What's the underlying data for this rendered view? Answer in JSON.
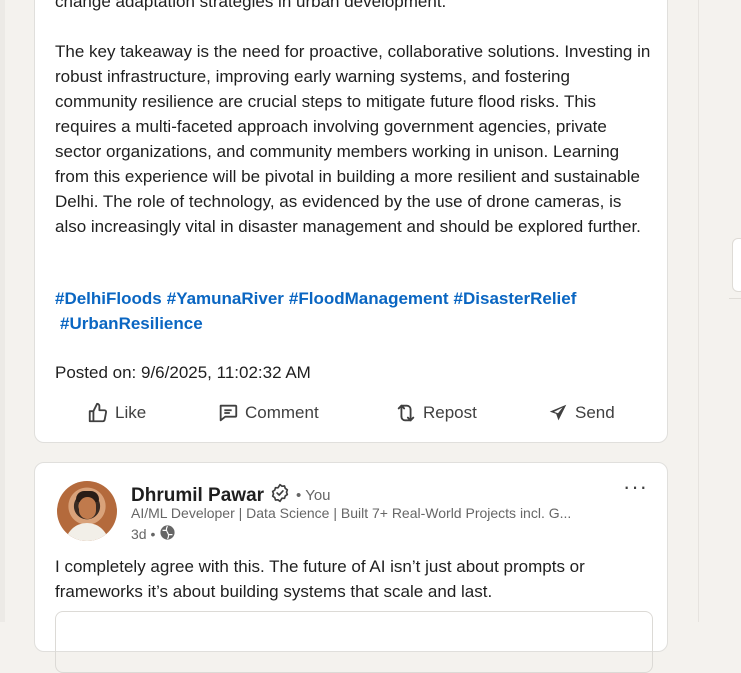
{
  "post": {
    "clipped_line": "change adaptation strategies in urban development.",
    "paragraph": "The key takeaway is the need for proactive, collaborative solutions. Investing in robust infrastructure, improving early warning systems, and fostering community resilience are crucial steps to mitigate future flood risks. This requires a multi-faceted approach involving government agencies, private sector organizations, and community members working in unison. Learning from this experience will be pivotal in building a more resilient and sustainable Delhi. The role of technology, as evidenced by the use of drone cameras, is also increasingly vital in disaster management and should be explored further.",
    "hashtags": [
      "#DelhiFloods",
      "#YamunaRiver",
      "#FloodManagement",
      "#DisasterRelief",
      "#UrbanResilience"
    ],
    "posted_on": "Posted on: 9/6/2025, 11:02:32 AM",
    "actions": {
      "like": "Like",
      "comment": "Comment",
      "repost": "Repost",
      "send": "Send"
    }
  },
  "comment": {
    "author": "Dhrumil Pawar",
    "you_label": "• You",
    "headline": "AI/ML Developer | Data Science | Built 7+ Real-World Projects incl. G...",
    "time": "3d •",
    "text": "I completely agree with this. The future of AI isn’t just about prompts or frameworks it’s about building systems that scale and last.",
    "more": "···"
  },
  "colors": {
    "link": "#0a66c2",
    "text": "#1f1f1f",
    "muted": "#666666",
    "background": "#f4f2ee"
  }
}
